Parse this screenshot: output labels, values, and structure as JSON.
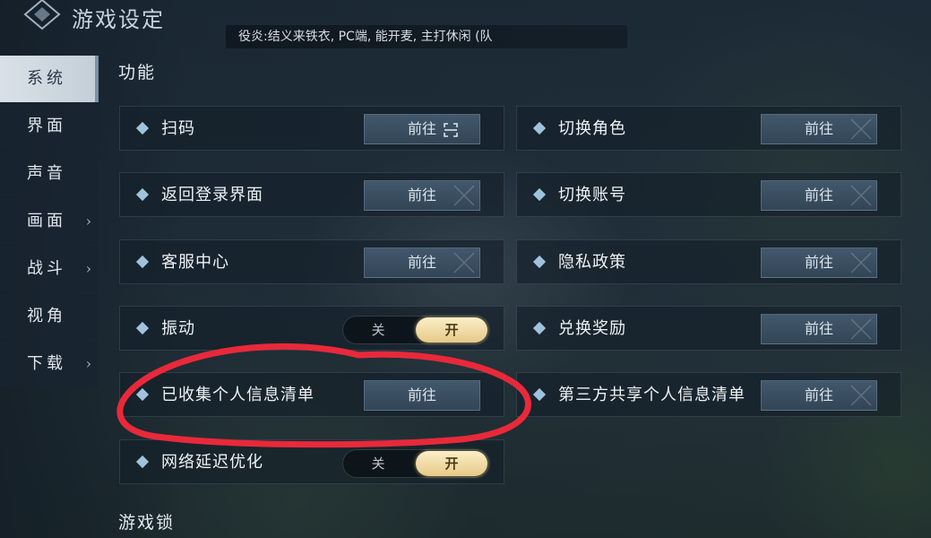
{
  "header": {
    "title": "游戏设定"
  },
  "marquee": {
    "text": "役炎:结义来铁衣, PC端, 能开麦, 主打休闲 (队"
  },
  "sidebar": {
    "items": [
      {
        "label": "系统",
        "chevron": ""
      },
      {
        "label": "界面",
        "chevron": ""
      },
      {
        "label": "声音",
        "chevron": ""
      },
      {
        "label": "画面",
        "chevron": "›"
      },
      {
        "label": "战斗",
        "chevron": "›"
      },
      {
        "label": "视角",
        "chevron": ""
      },
      {
        "label": "下载",
        "chevron": "›"
      }
    ]
  },
  "sections": {
    "function": "功能",
    "gamelock": "游戏锁"
  },
  "go_label": "前往",
  "toggle": {
    "off": "关",
    "on": "开"
  },
  "left": [
    {
      "label": "扫码",
      "type": "button"
    },
    {
      "label": "返回登录界面",
      "type": "button"
    },
    {
      "label": "客服中心",
      "type": "button"
    },
    {
      "label": "振动",
      "type": "toggle",
      "value": "开"
    },
    {
      "label": "已收集个人信息清单",
      "type": "button"
    },
    {
      "label": "网络延迟优化",
      "type": "toggle",
      "value": "开"
    }
  ],
  "right": [
    {
      "label": "切换角色",
      "type": "button"
    },
    {
      "label": "切换账号",
      "type": "button"
    },
    {
      "label": "隐私政策",
      "type": "button"
    },
    {
      "label": "兑换奖励",
      "type": "button"
    },
    {
      "label": "第三方共享个人信息清单",
      "type": "button"
    }
  ],
  "colors": {
    "toggle_on": "#e6c988",
    "annotation": "#e8293a",
    "diamond": "#9fc3dd"
  }
}
